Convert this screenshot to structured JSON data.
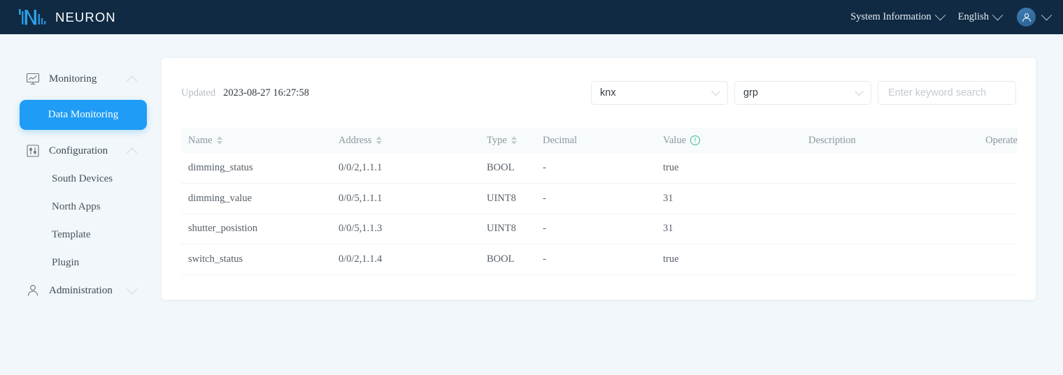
{
  "topbar": {
    "brand_name": "NEURON",
    "logo_icon": "neuron-logo-icon",
    "system_information_label": "System Information",
    "language_label": "English",
    "avatar_icon": "user-avatar-icon"
  },
  "sidebar": {
    "groups": [
      {
        "label": "Monitoring",
        "icon": "monitor-chart-icon",
        "expanded": true
      },
      {
        "label": "Configuration",
        "icon": "sliders-icon",
        "expanded": true
      },
      {
        "label": "Administration",
        "icon": "user-icon",
        "expanded": false
      }
    ],
    "active_item": "Data Monitoring",
    "config_items": [
      "South Devices",
      "North Apps",
      "Template",
      "Plugin"
    ]
  },
  "toolbar": {
    "updated_label": "Updated",
    "updated_value": "2023-08-27 16:27:58",
    "node_select_value": "knx",
    "group_select_value": "grp",
    "search_placeholder": "Enter keyword search",
    "search_value": ""
  },
  "table": {
    "columns": [
      {
        "label": "Name",
        "sortable": true,
        "info": false
      },
      {
        "label": "Address",
        "sortable": true,
        "info": false
      },
      {
        "label": "Type",
        "sortable": true,
        "info": false
      },
      {
        "label": "Decimal",
        "sortable": false,
        "info": false
      },
      {
        "label": "Value",
        "sortable": false,
        "info": true
      },
      {
        "label": "Description",
        "sortable": false,
        "info": false
      },
      {
        "label": "Operate",
        "sortable": false,
        "info": false
      }
    ],
    "rows": [
      {
        "name": "dimming_status",
        "address": "0/0/2,1.1.1",
        "type": "BOOL",
        "decimal": "-",
        "value": "true",
        "description": "",
        "operate": ""
      },
      {
        "name": "dimming_value",
        "address": "0/0/5,1.1.1",
        "type": "UINT8",
        "decimal": "-",
        "value": "31",
        "description": "",
        "operate": ""
      },
      {
        "name": "shutter_posistion",
        "address": "0/0/5,1.1.3",
        "type": "UINT8",
        "decimal": "-",
        "value": "31",
        "description": "",
        "operate": ""
      },
      {
        "name": "switch_status",
        "address": "0/0/2,1.1.4",
        "type": "BOOL",
        "decimal": "-",
        "value": "true",
        "description": "",
        "operate": ""
      }
    ]
  },
  "colors": {
    "topbar_bg": "#0f2a42",
    "accent_blue": "#1f9cf5",
    "page_bg": "#f1f7fa",
    "info_green": "#3fba8f"
  }
}
